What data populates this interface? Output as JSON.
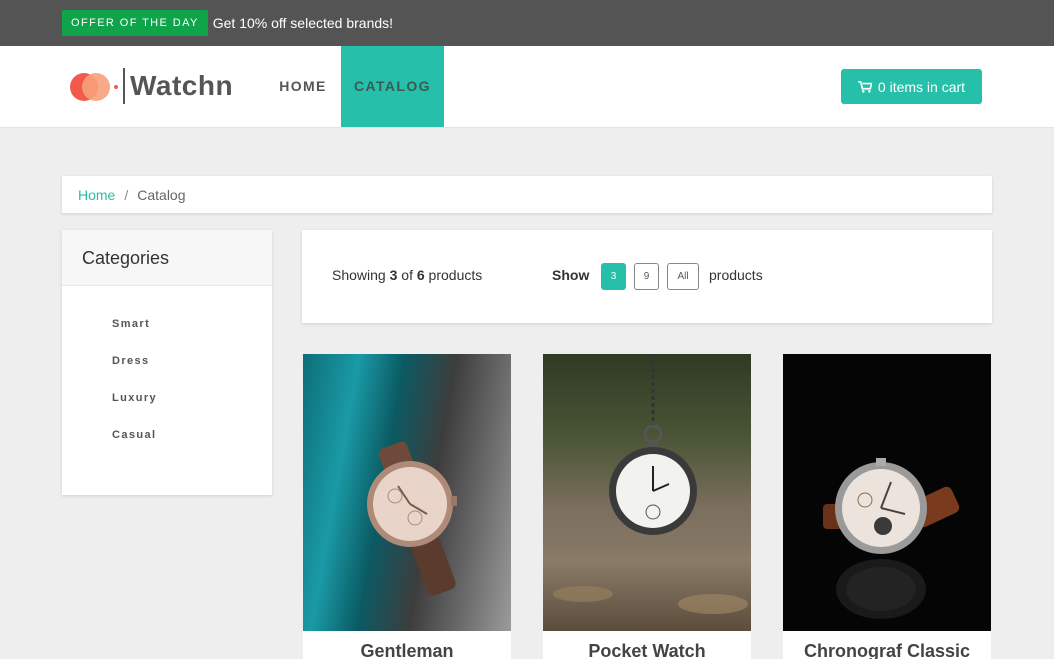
{
  "offer": {
    "badge": "OFFER OF THE DAY",
    "text": "Get 10% off selected brands!"
  },
  "brand": {
    "name": "Watchn"
  },
  "nav": {
    "home": "HOME",
    "catalog": "CATALOG"
  },
  "cart": {
    "label": "0 items in cart",
    "icon": "shopping-cart-icon"
  },
  "breadcrumb": {
    "home": "Home",
    "separator": "/",
    "current": "Catalog"
  },
  "categories": {
    "title": "Categories",
    "items": [
      "Smart",
      "Dress",
      "Luxury",
      "Casual"
    ]
  },
  "toolbar": {
    "showing_prefix": "Showing",
    "shown": "3",
    "of": "of",
    "total": "6",
    "products_suffix": "products",
    "show_label": "Show",
    "page_sizes": [
      "3",
      "9",
      "All"
    ],
    "selected_page_size": "3",
    "products_label": "products"
  },
  "products": [
    {
      "name": "Gentleman"
    },
    {
      "name": "Pocket Watch"
    },
    {
      "name": "Chronograf Classic"
    }
  ],
  "colors": {
    "accent": "#26bfa9",
    "offer_green": "#0fa34a",
    "topbar": "#555454"
  }
}
